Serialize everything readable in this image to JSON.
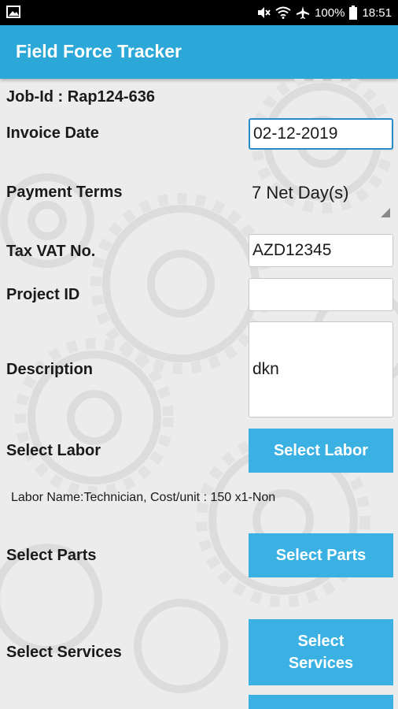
{
  "status_bar": {
    "battery_percent": "100%",
    "time": "18:51",
    "icons": [
      "gallery-icon",
      "mute-icon",
      "wifi-icon",
      "airplane-icon",
      "battery-icon"
    ]
  },
  "app_bar": {
    "title": "Field Force Tracker",
    "color": "#2ba7d8"
  },
  "form": {
    "job_id": "Job-Id : Rap124-636",
    "invoice_date": {
      "label": "Invoice Date",
      "value": "02-12-2019"
    },
    "payment_terms": {
      "label": "Payment Terms",
      "value": "7 Net Day(s)"
    },
    "tax_vat": {
      "label": "Tax VAT No.",
      "value": "AZD12345"
    },
    "project_id": {
      "label": "Project ID",
      "value": ""
    },
    "description": {
      "label": "Description",
      "value": "dkn"
    },
    "labor": {
      "label": "Select Labor",
      "button": "Select Labor",
      "info": "Labor Name:Technician, Cost/unit : 150 x1-Non"
    },
    "parts": {
      "label": "Select Parts",
      "button": "Select Parts"
    },
    "services": {
      "label": "Select Services",
      "button_line1": "Select",
      "button_line2": "Services"
    }
  },
  "colors": {
    "button": "#3ab1e2",
    "focus_border": "#2a8ac8"
  }
}
